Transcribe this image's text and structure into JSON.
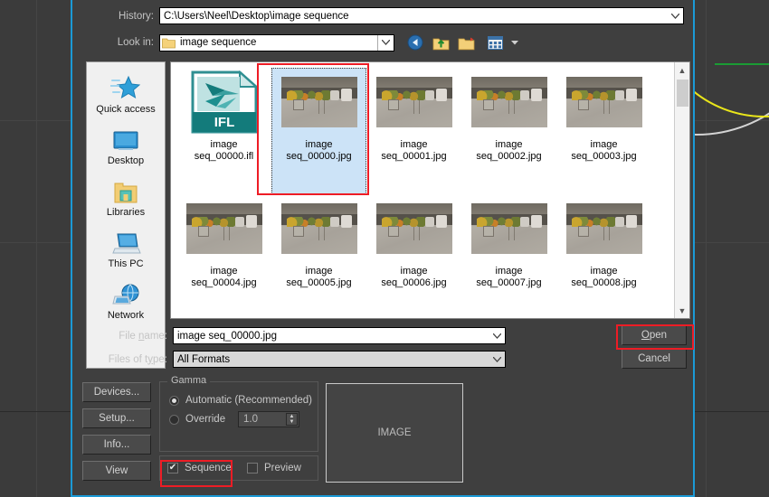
{
  "viewport": {
    "name": "3ds-max-viewport",
    "grid_color": "#454545",
    "arc_colors": [
      "#d9d9d9",
      "#e9e51a"
    ],
    "axis_color": "#1a9b33"
  },
  "dialog": {
    "accent_border": "#1b9ad6",
    "background": "#3f3f3f",
    "history": {
      "label": "History:",
      "value": "C:\\Users\\Neel\\Desktop\\image sequence"
    },
    "lookin": {
      "label": "Look in:",
      "value": "image sequence",
      "icon": "folder-icon"
    },
    "toolbar": [
      {
        "name": "back-icon",
        "title": "Back"
      },
      {
        "name": "up-folder-icon",
        "title": "Up one level"
      },
      {
        "name": "new-folder-icon",
        "title": "Create New Folder"
      },
      {
        "name": "views-icon",
        "title": "Views"
      },
      {
        "name": "views-chevron-icon",
        "title": "Views menu"
      }
    ],
    "places": [
      {
        "label": "Quick access",
        "icon": "star-icon"
      },
      {
        "label": "Desktop",
        "icon": "monitor-icon"
      },
      {
        "label": "Libraries",
        "icon": "library-folder-icon"
      },
      {
        "label": "This PC",
        "icon": "computer-icon"
      },
      {
        "label": "Network",
        "icon": "network-globe-icon"
      }
    ],
    "files": [
      {
        "line1": "image",
        "line2": "seq_00000.ifl",
        "type": "ifl",
        "selected": false
      },
      {
        "line1": "image",
        "line2": "seq_00000.jpg",
        "type": "photo",
        "selected": true
      },
      {
        "line1": "image",
        "line2": "seq_00001.jpg",
        "type": "photo",
        "selected": false
      },
      {
        "line1": "image",
        "line2": "seq_00002.jpg",
        "type": "photo",
        "selected": false
      },
      {
        "line1": "image",
        "line2": "seq_00003.jpg",
        "type": "photo",
        "selected": false
      },
      {
        "line1": "image",
        "line2": "seq_00004.jpg",
        "type": "photo",
        "selected": false
      },
      {
        "line1": "image",
        "line2": "seq_00005.jpg",
        "type": "photo",
        "selected": false
      },
      {
        "line1": "image",
        "line2": "seq_00006.jpg",
        "type": "photo",
        "selected": false
      },
      {
        "line1": "image",
        "line2": "seq_00007.jpg",
        "type": "photo",
        "selected": false
      },
      {
        "line1": "image",
        "line2": "seq_00008.jpg",
        "type": "photo",
        "selected": false
      }
    ],
    "ifl_badge": "IFL",
    "filename": {
      "label": "File name:",
      "value": "image seq_00000.jpg"
    },
    "filetype": {
      "label": "Files of type:",
      "value": "All Formats"
    },
    "open_button": "Open",
    "cancel_button": "Cancel",
    "side_buttons": [
      "Devices...",
      "Setup...",
      "Info...",
      "View"
    ],
    "gamma": {
      "title": "Gamma",
      "automatic_label": "Automatic (Recommended)",
      "override_label": "Override",
      "override_value": "1.0",
      "selected": "automatic"
    },
    "sequence": {
      "label": "Sequence",
      "checked": true,
      "mark": "✔"
    },
    "preview": {
      "label": "Preview",
      "checked": false,
      "mark": ""
    },
    "image_preview": {
      "label": "IMAGE"
    },
    "scrollbar": {
      "up": "▲",
      "down": "▼"
    }
  },
  "annotations": {
    "color": "#ee1c25",
    "boxes": [
      "selected-file-thumbnail",
      "open-button",
      "sequence-checkbox"
    ]
  }
}
